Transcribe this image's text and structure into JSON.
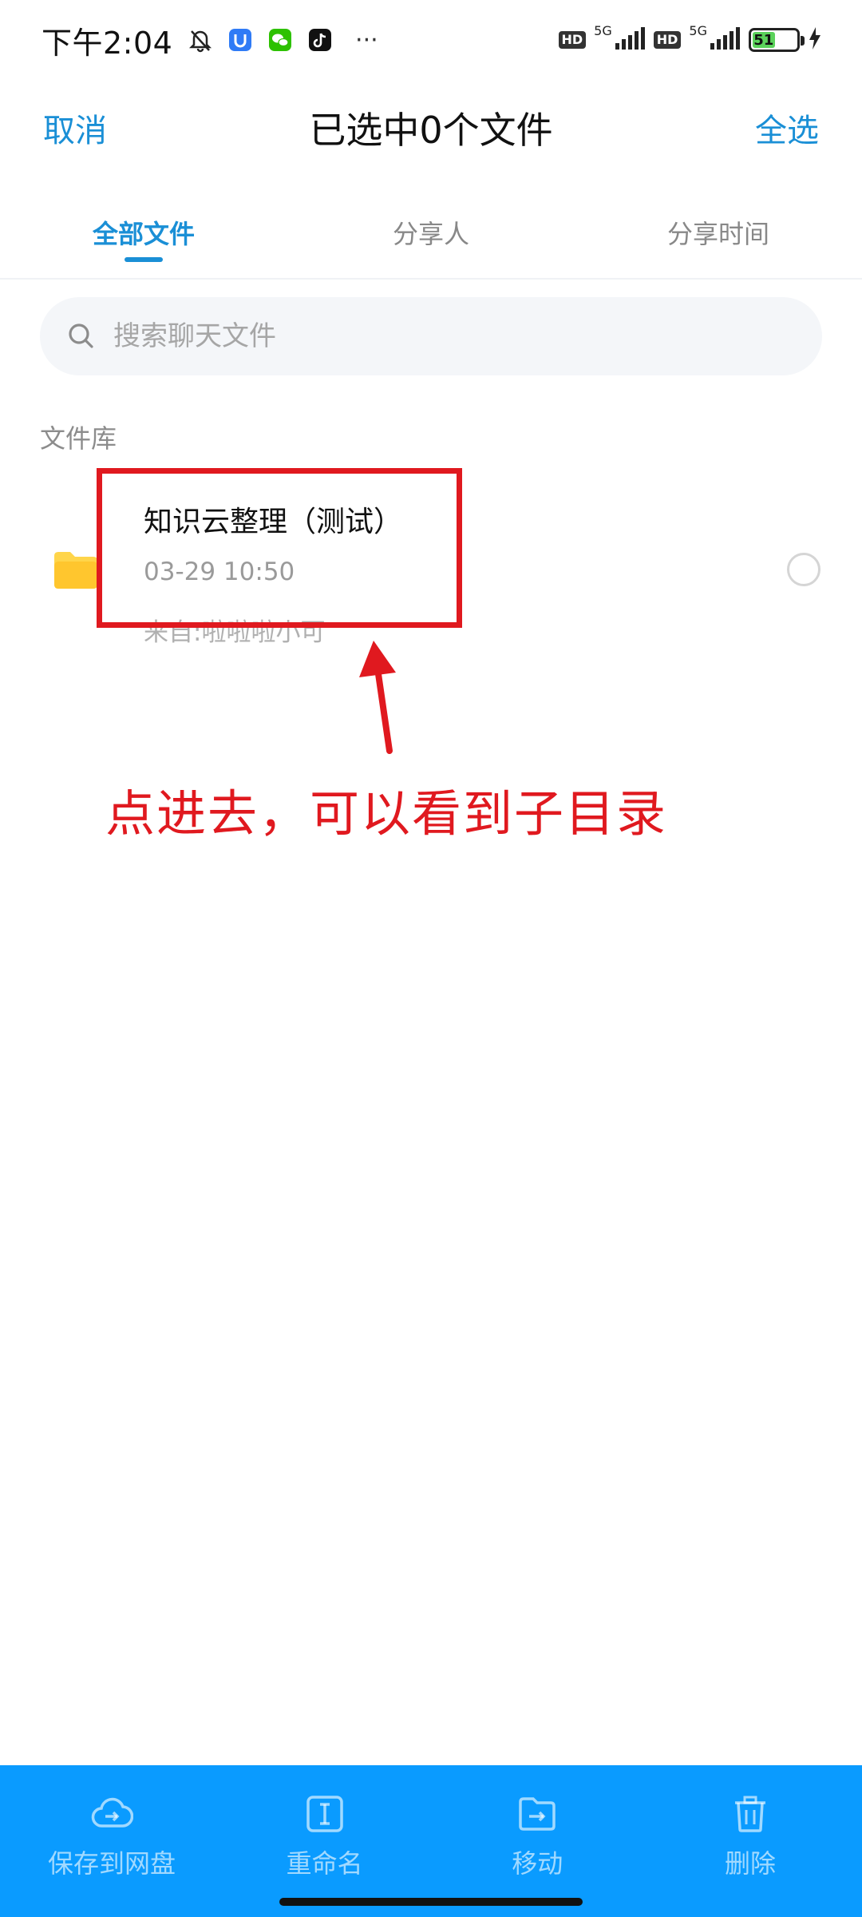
{
  "status_bar": {
    "time": "下午2:04",
    "net_1": "5G",
    "net_2": "5G",
    "hd_1": "HD",
    "hd_2": "HD",
    "battery": "51",
    "more": "···"
  },
  "header": {
    "cancel_label": "取消",
    "title": "已选中0个文件",
    "select_all_label": "全选"
  },
  "tabs": [
    {
      "label": "全部文件",
      "active": true
    },
    {
      "label": "分享人",
      "active": false
    },
    {
      "label": "分享时间",
      "active": false
    }
  ],
  "search": {
    "placeholder": "搜索聊天文件",
    "value": ""
  },
  "section_label": "文件库",
  "files": [
    {
      "name": "知识云整理（测试）",
      "date": "03-29  10:50",
      "from": "来自:啦啦啦小可",
      "selected": false
    }
  ],
  "annotation": {
    "text": "点进去，可以看到子目录",
    "color": "#e0191f"
  },
  "actions": [
    {
      "label": "保存到网盘",
      "icon": "cloud-upload-icon"
    },
    {
      "label": "重命名",
      "icon": "rename-icon"
    },
    {
      "label": "移动",
      "icon": "move-folder-icon"
    },
    {
      "label": "删除",
      "icon": "trash-icon"
    }
  ],
  "colors": {
    "accent": "#1a8fd6",
    "bottom_bar": "#0a9bff",
    "folder": "#ffd54a",
    "annotation": "#e0191f"
  }
}
